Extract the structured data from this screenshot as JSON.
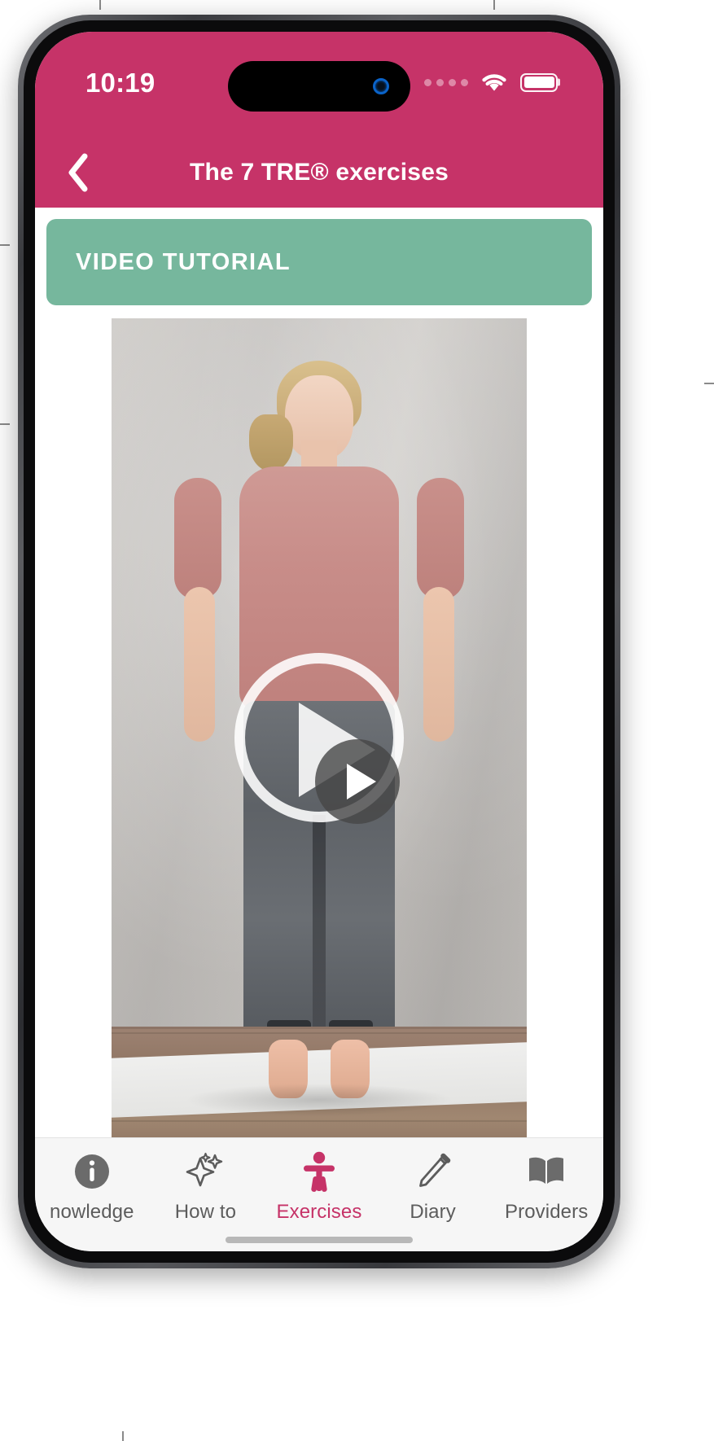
{
  "theme": {
    "brand_color": "#c63368",
    "card_color": "#76b79d",
    "tabbar_bg": "#f6f6f6",
    "tab_inactive_color": "#5c5c5c"
  },
  "status_bar": {
    "time": "10:19",
    "signal_icon": "cellular-signal-icon",
    "wifi_icon": "wifi-icon",
    "battery_icon": "battery-full-icon",
    "dynamic_island": "dynamic-island",
    "front_camera": "front-camera-icon"
  },
  "nav_bar": {
    "back_icon": "chevron-left-icon",
    "title": "The 7 TRE® exercises"
  },
  "content": {
    "tutorial_card": {
      "label": "VIDEO TUTORIAL"
    },
    "video": {
      "play_button_large_icon": "play-circle-outline-icon",
      "play_button_small_icon": "play-circle-filled-icon",
      "description": "Woman standing barefoot on a mat in front of a grey wall"
    }
  },
  "tab_bar": {
    "active_index": 2,
    "items": [
      {
        "label": "nowledge",
        "icon": "info-circle-icon",
        "name": "knowledge"
      },
      {
        "label": "How to",
        "icon": "sparkles-icon",
        "name": "how-to"
      },
      {
        "label": "Exercises",
        "icon": "person-stretch-icon",
        "name": "exercises"
      },
      {
        "label": "Diary",
        "icon": "pencil-icon",
        "name": "diary"
      },
      {
        "label": "Providers",
        "icon": "open-book-icon",
        "name": "providers"
      }
    ]
  }
}
